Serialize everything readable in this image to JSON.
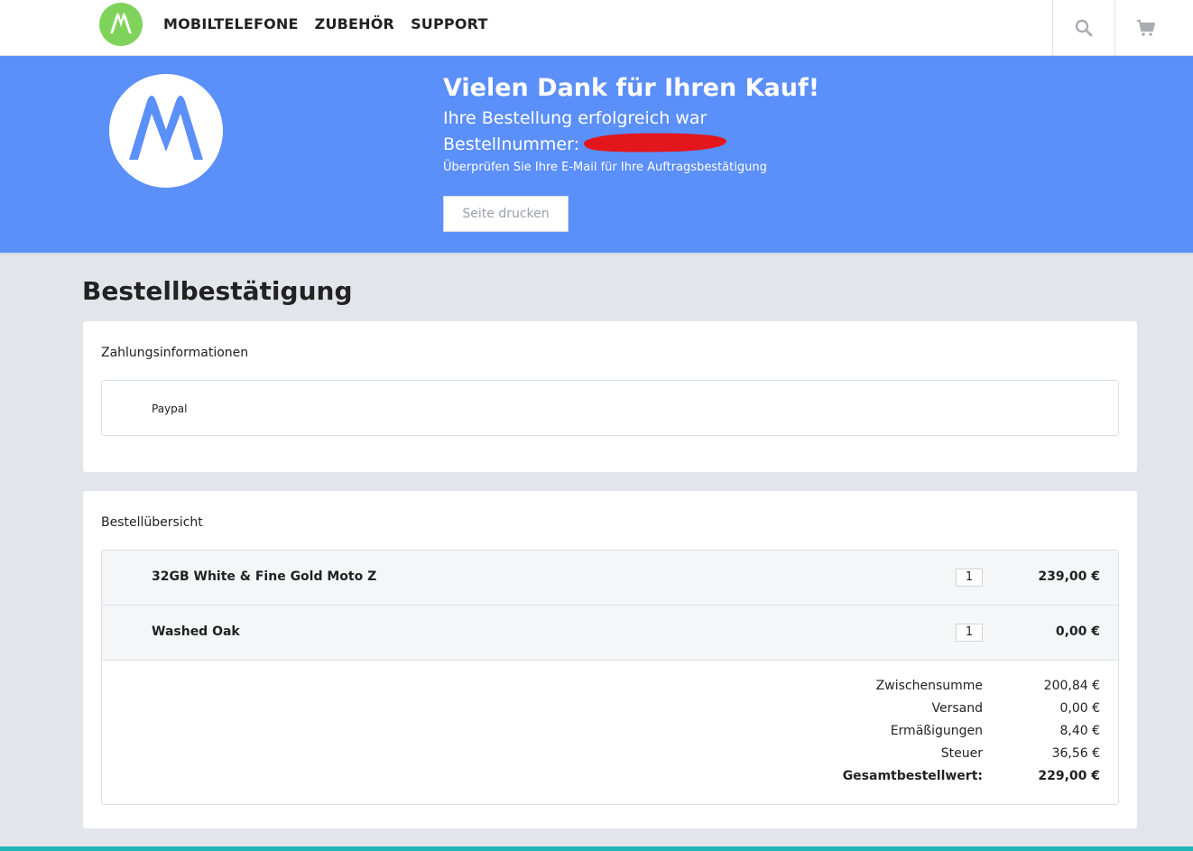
{
  "header": {
    "nav": [
      "MOBILTELEFONE",
      "ZUBEHÖR",
      "SUPPORT"
    ],
    "icons": {
      "search": "search-icon",
      "cart": "cart-icon"
    },
    "brand_color": "#7fd35a"
  },
  "hero": {
    "title": "Vielen Dank für Ihren Kauf!",
    "subtitle": "Ihre Bestellung erfolgreich war",
    "order_label": "Bestellnummer:",
    "note": "Überprüfen Sie Ihre E-Mail für Ihre Auftragsbestätigung",
    "print_button": "Seite drucken",
    "background_color": "#5b8ff9"
  },
  "main": {
    "page_title": "Bestellbestätigung",
    "payment": {
      "label": "Zahlungsinformationen",
      "method": "Paypal"
    },
    "summary": {
      "label": "Bestellübersicht",
      "items": [
        {
          "name": "32GB White & Fine Gold Moto Z",
          "qty": "1",
          "price": "239,00 €"
        },
        {
          "name": "Washed Oak",
          "qty": "1",
          "price": "0,00 €"
        }
      ],
      "totals": [
        {
          "label": "Zwischensumme",
          "value": "200,84 €"
        },
        {
          "label": "Versand",
          "value": "0,00 €"
        },
        {
          "label": "Ermäßigungen",
          "value": "8,40 €"
        },
        {
          "label": "Steuer",
          "value": "36,56 €"
        },
        {
          "label": "Gesamtbestellwert:",
          "value": "229,00 €"
        }
      ]
    }
  }
}
